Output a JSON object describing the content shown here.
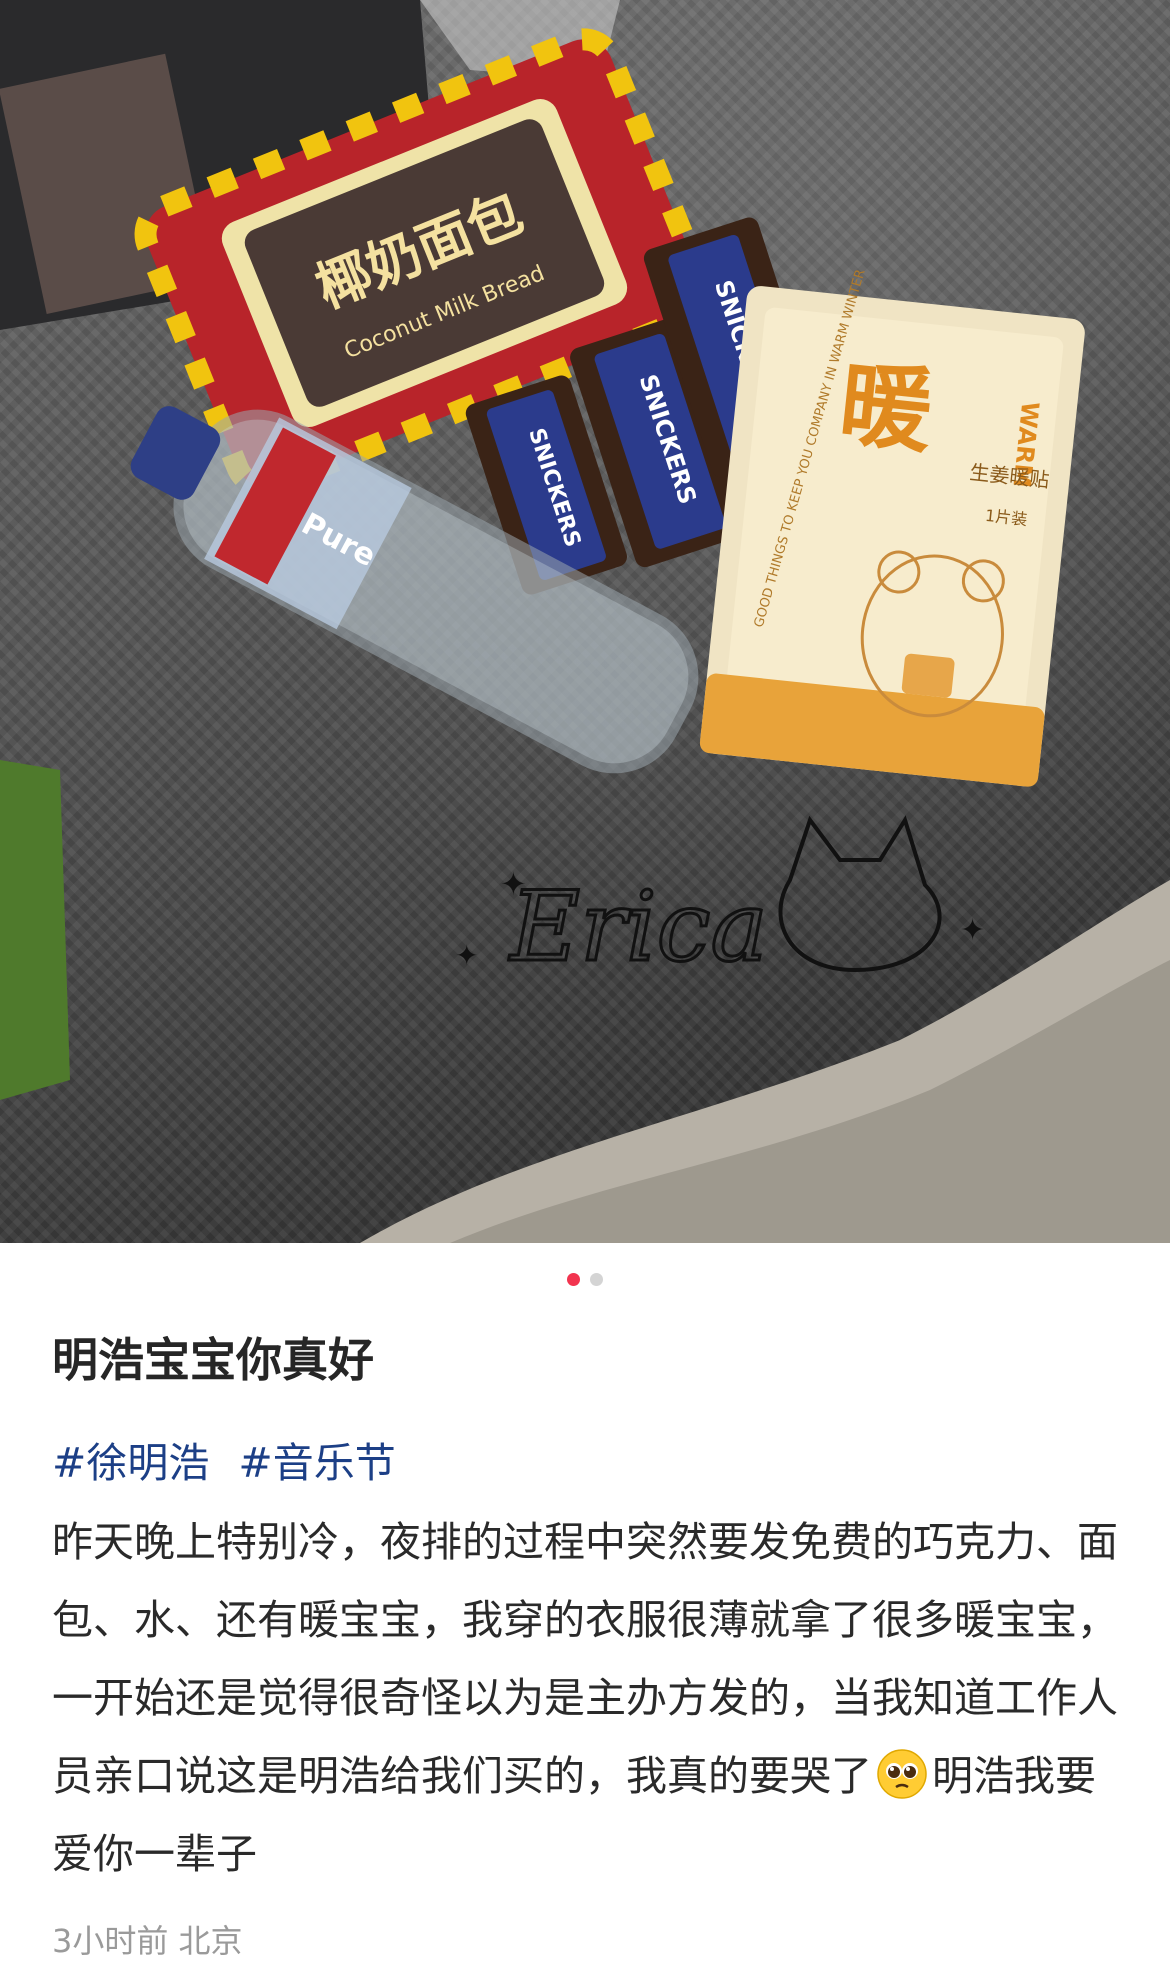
{
  "photo": {
    "bread_label": "椰奶面包",
    "bread_english": "Coconut Milk Bread",
    "candy_label": "SNICKERS",
    "water_label": "Pure",
    "pack_big_char": "暖",
    "pack_warm": "WARM",
    "pack_product": "生姜暖贴",
    "pack_count": "1片装",
    "pack_slogan": "GOOD THINGS TO KEEP YOU COMPANY IN WARM WINTER",
    "watermark": "Erica",
    "carousel_total": 2,
    "carousel_index": 1
  },
  "post": {
    "title": "明浩宝宝你真好",
    "tags": [
      "#徐明浩",
      "#音乐节"
    ],
    "body_part1": "昨天晚上特别冷，夜排的过程中突然要发免费的巧克力、面包、水、还有暖宝宝，我穿的衣服很薄就拿了很多暖宝宝，一开始还是觉得很奇怪以为是主办方发的，当我知道工作人员亲口说这是明浩给我们买的，我真的要哭了",
    "emoji": "pleading-face",
    "body_part2": "明浩我要爱你一辈子",
    "time": "3小时前",
    "location": "北京"
  },
  "colors": {
    "active_dot": "#f2344f",
    "tag": "#1c3f86"
  }
}
